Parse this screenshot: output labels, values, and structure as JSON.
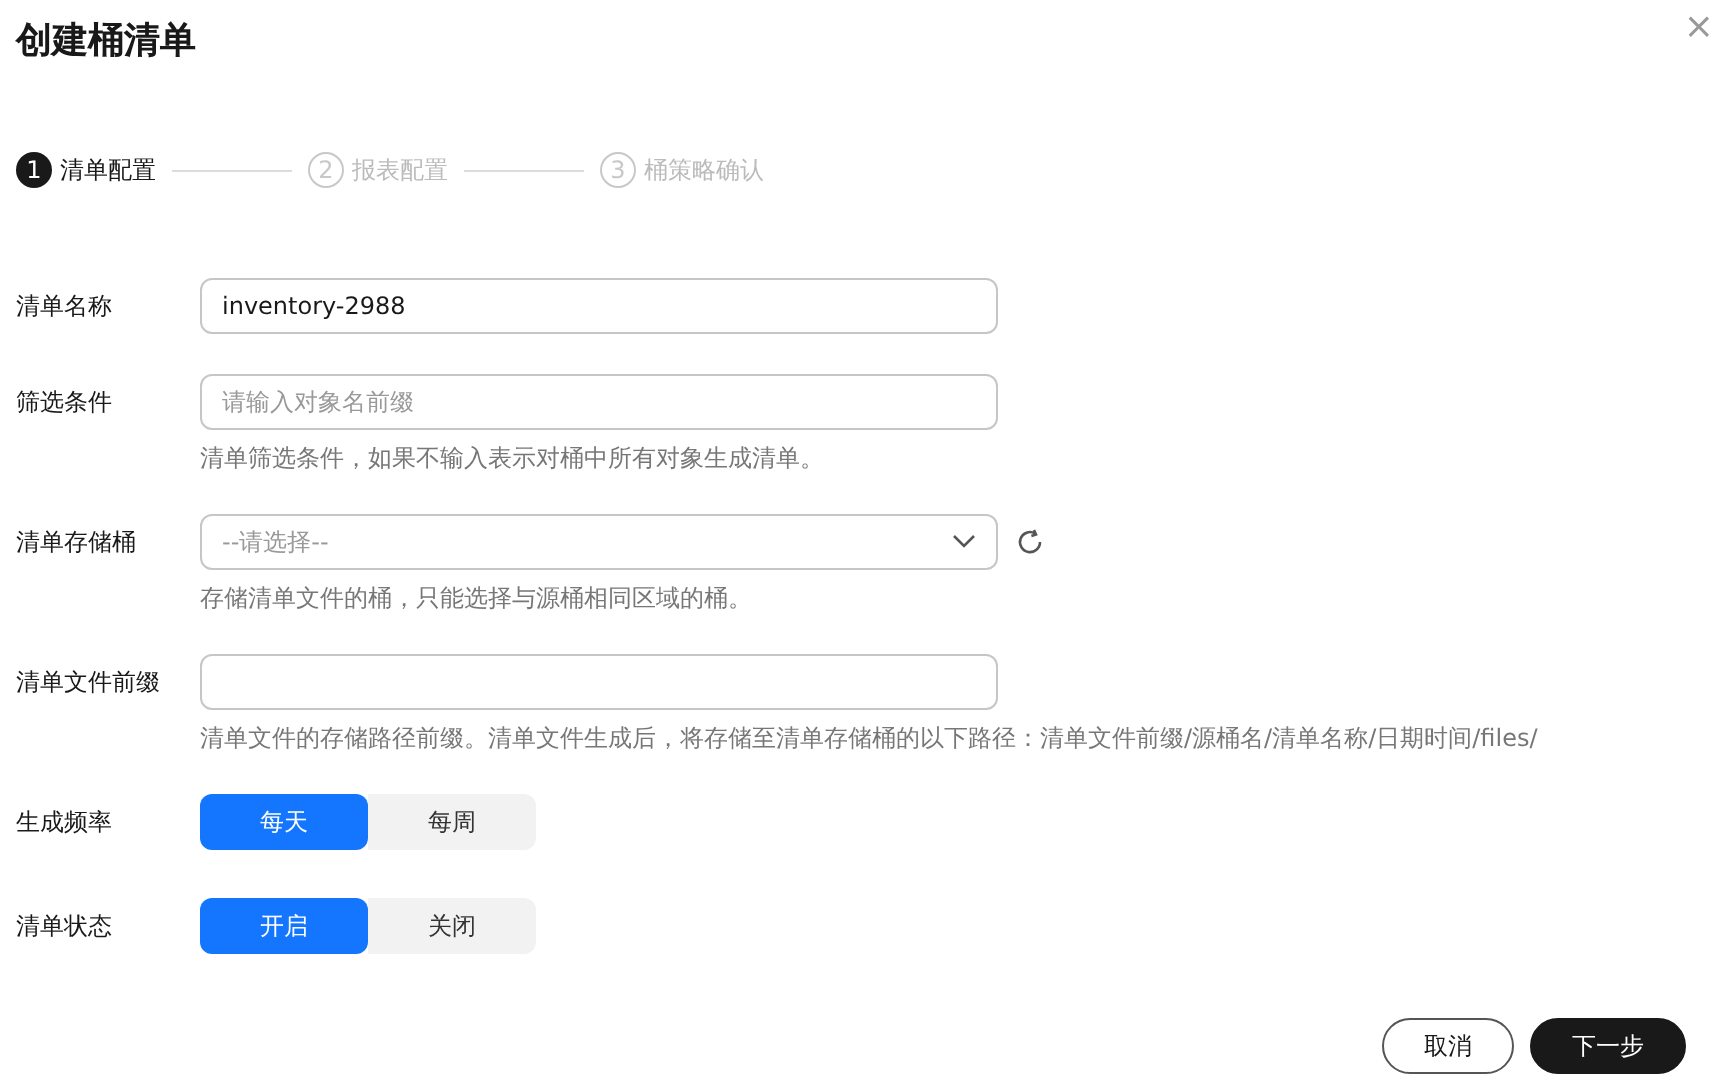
{
  "title": "创建桶清单",
  "close": "×",
  "steps": [
    {
      "number": "1",
      "label": "清单配置",
      "selected": true
    },
    {
      "number": "2",
      "label": "报表配置",
      "selected": false
    },
    {
      "number": "3",
      "label": "桶策略确认",
      "selected": false
    }
  ],
  "fields": [
    {
      "kind": "text",
      "label": "清单名称",
      "value": "inventory-2988"
    },
    {
      "kind": "text",
      "label": "筛选条件",
      "placeholder": "请输入对象名前缀",
      "hint": "清单筛选条件，如果不输入表示对桶中所有对象生成清单。"
    },
    {
      "kind": "select",
      "label": "清单存储桶",
      "placeholder": "--请选择--",
      "hint": "存储清单文件的桶，只能选择与源桶相同区域的桶。"
    },
    {
      "kind": "text",
      "label": "清单文件前缀",
      "hint": "清单文件的存储路径前缀。清单文件生成后，将存储至清单存储桶的以下路径：清单文件前缀/源桶名/清单名称/日期时间/files/"
    },
    {
      "kind": "segmented",
      "label": "生成频率",
      "options": [
        {
          "label": "每天",
          "selected": true
        },
        {
          "label": "每周",
          "selected": false
        }
      ]
    },
    {
      "kind": "segmented",
      "label": "清单状态",
      "options": [
        {
          "label": "开启",
          "selected": true
        },
        {
          "label": "关闭",
          "selected": false
        }
      ]
    }
  ],
  "buttons": [
    {
      "label": "取消",
      "kind": "secondary"
    },
    {
      "label": "下一步",
      "kind": "primary"
    }
  ]
}
